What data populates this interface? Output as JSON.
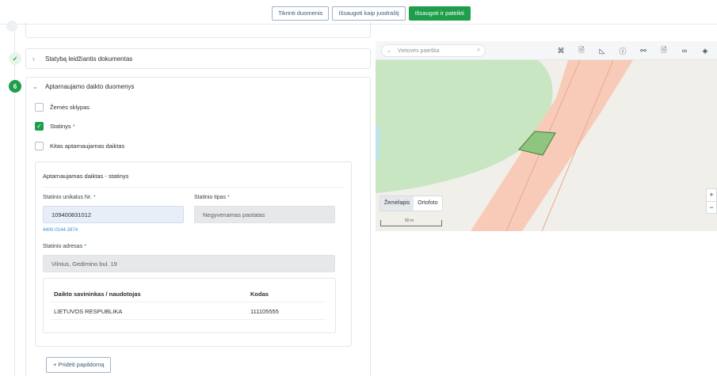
{
  "toolbar": {
    "check_data": "Tikrinti duomenis",
    "save_draft": "Išsaugoti kaip juodraštį",
    "save_submit": "Išsaugoti ir pateikti"
  },
  "steps": {
    "step5_title": "Statybą leidžiantis dokumentas",
    "step5_icon": "check-icon",
    "step6_number": "6",
    "step6_title": "Aptarnaujamo daikto duomenys"
  },
  "object_types": [
    {
      "label": "Žemės sklypas",
      "checked": false,
      "required": false
    },
    {
      "label": "Statinys",
      "checked": true,
      "required": true
    },
    {
      "label": "Kitas aptarnaujamas daiktas",
      "checked": false,
      "required": false
    }
  ],
  "object_card": {
    "title": "Aptarnaujamas daiktas - statinys",
    "unique_no_label": "Statinio unikalus Nr.",
    "unique_no_value": "109400831012",
    "unique_no_hint": "4400-0144-2874",
    "type_label": "Statinio tipas",
    "type_value": "Negyvenamas pastatas",
    "address_label": "Statinio adresas",
    "address_value": "Vilnius, Gedimino bul. 19",
    "required_mark": "*"
  },
  "owner_table": {
    "headers": [
      "Daikto savininkas / naudotojas",
      "Kodas"
    ],
    "rows": [
      [
        "LIETUVOS RESPUBLIKA",
        "111105555"
      ]
    ]
  },
  "add_button": "+ Pridėti papildomą",
  "map": {
    "search_placeholder": "Vietovės paieška",
    "tools": [
      "crosshair-icon",
      "document-icon",
      "measure-icon",
      "info-icon",
      "link-icon",
      "document-icon",
      "link-icon",
      "layers-icon"
    ],
    "layers": [
      "Žemėlapis",
      "Ortofoto"
    ],
    "active_layer": "Žemėlapis",
    "scale_label": "50 m",
    "zoom_in": "+",
    "zoom_out": "−",
    "colors": {
      "forest": "#c9e6c3",
      "road": "#f7cbb8",
      "road_edge": "#e9a992",
      "parcel": "#8fc67f",
      "water": "#bfe3ea"
    }
  }
}
